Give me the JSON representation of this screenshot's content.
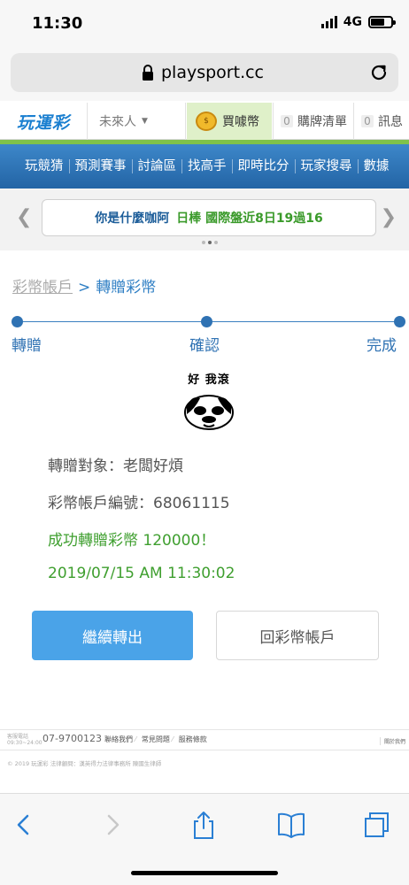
{
  "status_bar": {
    "time": "11:30",
    "network": "4G"
  },
  "browser": {
    "url": "playsport.cc"
  },
  "site_header": {
    "logo": "玩運彩",
    "user_menu": "未來人",
    "buy_coins": "買噱幣",
    "cart": {
      "count": "0",
      "label": "購牌清單"
    },
    "messages": {
      "count": "0",
      "label": "訊息"
    }
  },
  "nav": {
    "items": [
      "玩競猜",
      "預測賽事",
      "討論區",
      "找高手",
      "即時比分",
      "玩家搜尋",
      "數據"
    ]
  },
  "ticker": {
    "user": "你是什麼咖阿",
    "badge": "日棒 國際盤近8日19過16"
  },
  "breadcrumb": {
    "parent": "彩幣帳戶",
    "separator": ">",
    "current": "轉贈彩幣"
  },
  "steps": [
    "轉贈",
    "確認",
    "完成"
  ],
  "meme": {
    "caption": "好 我滾"
  },
  "result": {
    "recipient": "轉贈對象：老闆好煩",
    "account_no": "彩幣帳戶編號：68061115",
    "success": "成功轉贈彩幣 120000！",
    "timestamp": "2019/07/15 AM 11:30:02"
  },
  "buttons": {
    "continue": "繼續轉出",
    "back": "回彩幣帳戶"
  },
  "footer": {
    "service_label": "客服電話",
    "service_hours": "09:30~24:00",
    "phone": "07-9700123",
    "links": [
      "聯絡我們",
      "常見問題",
      "服務條款"
    ],
    "right_link": "關於我們",
    "copyright": "© 2019 玩運彩 法律顧問：漢英得力法律事務所 陳國生律師"
  },
  "colors": {
    "primary_blue": "#2f72b3",
    "button_blue": "#4aa3e8",
    "success_green": "#3f9f2f",
    "nav_blue": "#2d73b8",
    "accent_green": "#7fc24a"
  }
}
